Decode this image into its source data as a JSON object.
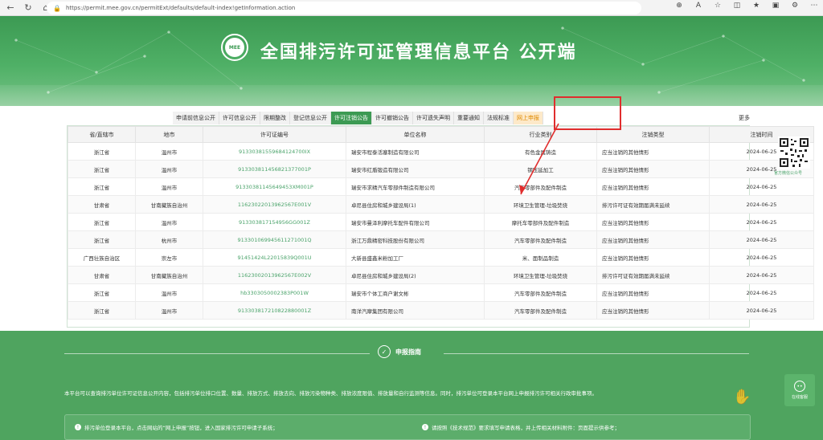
{
  "browser": {
    "url": "https://permit.mee.gov.cn/permitExt/defaults/default-index!getInformation.action",
    "nav_icons": [
      "back-icon",
      "refresh-icon",
      "home-icon"
    ],
    "tool_icons": [
      "zoom-icon",
      "read-aloud-icon",
      "favorite-icon",
      "split-screen-icon",
      "favorites-bar-icon",
      "collections-icon",
      "extensions-icon",
      "more-icon"
    ]
  },
  "banner": {
    "emblem_text": "MEE",
    "title": "全国排污许可证管理信息平台  公开端"
  },
  "tabs": [
    {
      "label": "申请前信息公开",
      "state": "normal"
    },
    {
      "label": "许可信息公开",
      "state": "normal"
    },
    {
      "label": "限期整改",
      "state": "normal"
    },
    {
      "label": "登记信息公开",
      "state": "normal"
    },
    {
      "label": "许可注销公告",
      "state": "active"
    },
    {
      "label": "许可撤销公告",
      "state": "normal"
    },
    {
      "label": "许可遗失声明",
      "state": "normal"
    },
    {
      "label": "重要通知",
      "state": "normal"
    },
    {
      "label": "法规标准",
      "state": "normal"
    },
    {
      "label": "网上申报",
      "state": "highlight"
    }
  ],
  "more_label": "更多",
  "table": {
    "headers": [
      "省/直辖市",
      "地市",
      "许可证编号",
      "单位名称",
      "行业类别",
      "注销类型",
      "注销时间"
    ],
    "rows": [
      [
        "浙江省",
        "温州市",
        "91330381559684124700IX",
        "瑞安市程泰活塞制造有限公司",
        "有色金属铸造",
        "应当注销的其他情形",
        "2024-06-25"
      ],
      [
        "浙江省",
        "温州市",
        "913303811456821377001P",
        "瑞安市红盾锻造有限公司",
        "钢压延加工",
        "应当注销的其他情形",
        "2024-06-25"
      ],
      [
        "浙江省",
        "温州市",
        "91330381145649453XM001P",
        "瑞安市求精汽车零部件制造有限公司",
        "汽车零部件及配件制造",
        "应当注销的其他情形",
        "2024-06-25"
      ],
      [
        "甘肃省",
        "甘南藏族自治州",
        "11623022013962567E001V",
        "卓尼县住房和城乡建设局(1)",
        "环境卫生管理-垃圾焚烧",
        "排污许可证有效期届满未延续",
        "2024-06-25"
      ],
      [
        "浙江省",
        "温州市",
        "913303817154956GG001Z",
        "瑞安市曼泽利摩托车配件有限公司",
        "摩托车零部件及配件制造",
        "应当注销的其他情形",
        "2024-06-25"
      ],
      [
        "浙江省",
        "杭州市",
        "913301069945611271001Q",
        "浙江万鼎精密科技股份有限公司",
        "汽车零部件及配件制造",
        "应当注销的其他情形",
        "2024-06-25"
      ],
      [
        "广西壮族自治区",
        "崇左市",
        "91451424L22015839Q001U",
        "大新县盛鑫米粉加工厂",
        "米、面制品制造",
        "应当注销的其他情形",
        "2024-06-25"
      ],
      [
        "甘肃省",
        "甘南藏族自治州",
        "11623002013962567E002V",
        "卓尼县住房和城乡建设局(2)",
        "环境卫生管理-垃圾焚烧",
        "排污许可证有效期届满未延续",
        "2024-06-25"
      ],
      [
        "浙江省",
        "温州市",
        "hb3303050002383P001W",
        "瑞安市个体工商户谢文彬",
        "汽车零部件及配件制造",
        "应当注销的其他情形",
        "2024-06-25"
      ],
      [
        "浙江省",
        "温州市",
        "913303817210822880001Z",
        "南洋汽摩集团有限公司",
        "汽车零部件及配件制造",
        "应当注销的其他情形",
        "2024-06-25"
      ]
    ]
  },
  "qr_label": "官方微信公众号",
  "guide": {
    "title": "申报指南",
    "notice": "本平台可以查询排污单位许可证信息公开内容，包括排污单位排口位置、数量、排放方式、排放去向、排放污染物种类、排放浓度限值、排放量和自行监测等信息。同时，排污单位可登录本平台网上申报排污许可相关行政审批事项。",
    "note_left": "排污单位登录本平台，点击网站的“网上申报”按钮，进入国家排污许可申请子系统；",
    "note_right": "请按照《技术规范》要求填写申请表格，并上传相关材料附件：页面提示供参考；",
    "service_label": "在线客服"
  },
  "colors": {
    "brand_green": "#3c9a53",
    "footer_green": "#4fa45f",
    "annotation_red": "#e02d2d",
    "highlight_orange": "#e08a00"
  }
}
